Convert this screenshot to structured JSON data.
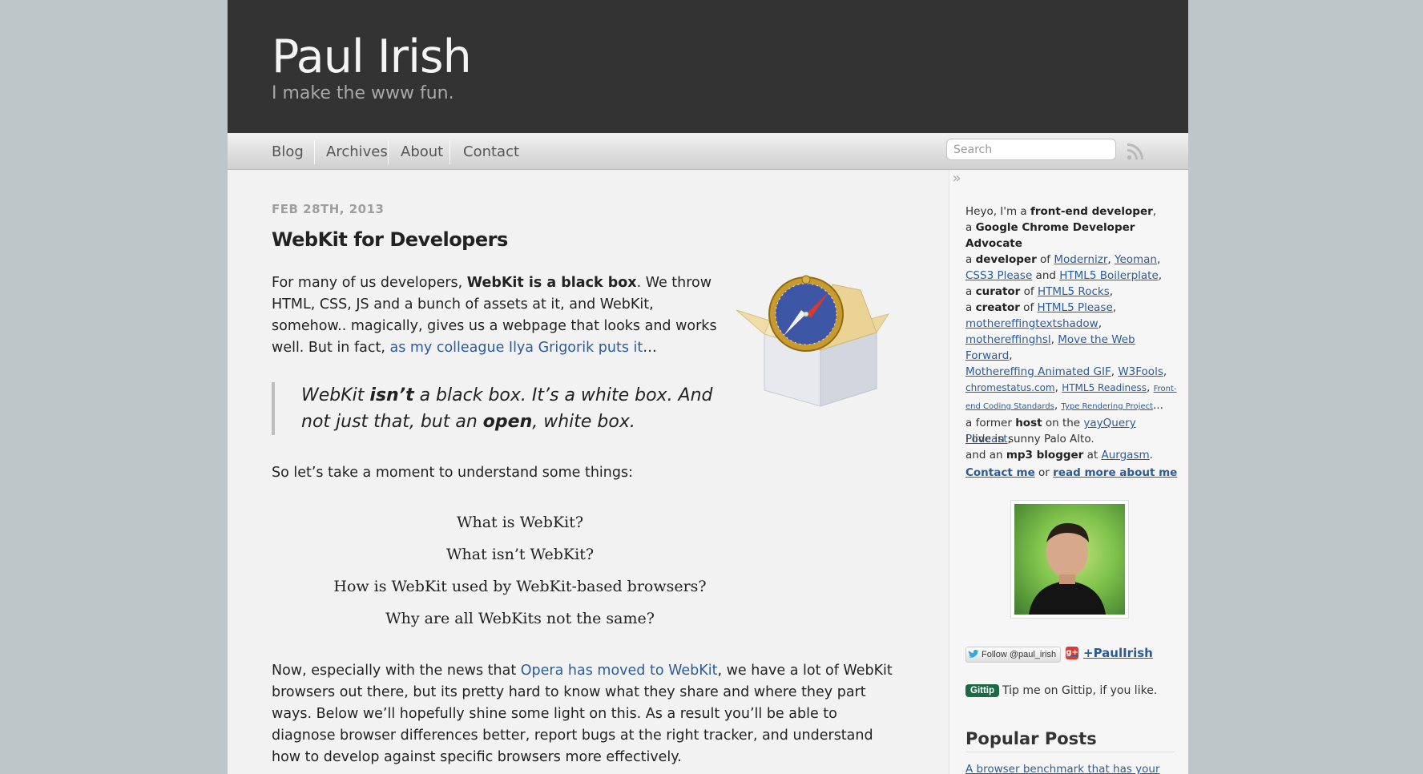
{
  "site": {
    "title": "Paul Irish",
    "tagline": "I make the www fun."
  },
  "nav": {
    "items": [
      {
        "label": "Blog"
      },
      {
        "label": "Archives"
      },
      {
        "label": "About"
      },
      {
        "label": "Contact"
      }
    ],
    "search_placeholder": "Search",
    "rss_icon": "rss-icon"
  },
  "post": {
    "date": "FEB 28TH, 2013",
    "title": "WebKit for Developers",
    "p1": {
      "pre": "For many of us developers, ",
      "bold": "WebKit is a black box",
      "mid": ". We throw HTML, CSS, JS and a bunch of assets at it, and WebKit, somehow.. magically, gives us a webpage that looks and works well. But in fact, ",
      "link": "as my colleague Ilya Grigorik puts it",
      "post": "…"
    },
    "quote": {
      "a": "WebKit ",
      "b": "isn’t",
      "c": " a black box. It’s a white box. And not just that, but an ",
      "d": "open",
      "e": ", white box."
    },
    "p2": "So let’s take a moment to understand some things:",
    "questions": [
      "What is WebKit?",
      "What isn’t WebKit?",
      "How is WebKit used by WebKit-based browsers?",
      "Why are all WebKits not the same?"
    ],
    "p3": {
      "pre": "Now, especially with the news that ",
      "link": "Opera has moved to WebKit",
      "post": ", we have a lot of WebKit browsers out there, but its pretty hard to know what they share and where they part ways. Below we’ll hopefully shine some light on this. As a result you’ll be able to diagnose browser differences better, report bugs at the right tracker, and understand how to develop against specific browsers more effectively."
    }
  },
  "sidebar": {
    "toggle": "»",
    "bio": {
      "l1a": "Heyo, I'm a ",
      "l1b": "front-end developer",
      "l1c": ",",
      "l2a": "a ",
      "l2b": "Google Chrome Developer Advocate",
      "l3a": "a ",
      "l3b": "developer",
      "l3c": " of ",
      "modernizr": "Modernizr",
      "yeoman": "Yeoman",
      "css3please": "CSS3 Please",
      "and": " and ",
      "h5bp": "HTML5 Boilerplate",
      "l4a": "a ",
      "l4b": "curator",
      "l4c": " of ",
      "html5rocks": "HTML5 Rocks",
      "l5a": "a ",
      "l5b": "creator",
      "l5c": " of ",
      "html5please": "HTML5 Please",
      "textshadow": "mothereffingtextshadow",
      "hsl": "mothereffinghsl",
      "mtwf": "Move the Web Forward",
      "gif": "Mothereffing Animated GIF",
      "w3fools": "W3Fools",
      "chromestatus": "chromestatus.com",
      "h5readiness": "HTML5 Readiness",
      "frontend": "Front-end Coding Standards",
      "typeproject": "Type Rendering Project",
      "ellipsis": "...",
      "host_a": "a former ",
      "host_b": "host",
      "host_c": " on the ",
      "yayquery": "yayQuery Podcast",
      "mp3_a": "and an ",
      "mp3_b": "mp3 blogger",
      "mp3_c": " at ",
      "aurgasm": "Aurgasm"
    },
    "location": "I live in sunny Palo Alto.",
    "contact": {
      "a": "Contact me",
      "or": " or ",
      "b": "read more about me"
    },
    "twitter": "Follow @paul_irish",
    "gplus": "+PaulIrish",
    "gittip_badge": "Gittip",
    "gittip_text": "Tip me on Gittip, if you like.",
    "popular_title": "Popular Posts",
    "popular_first": "A browser benchmark that has your back:"
  }
}
